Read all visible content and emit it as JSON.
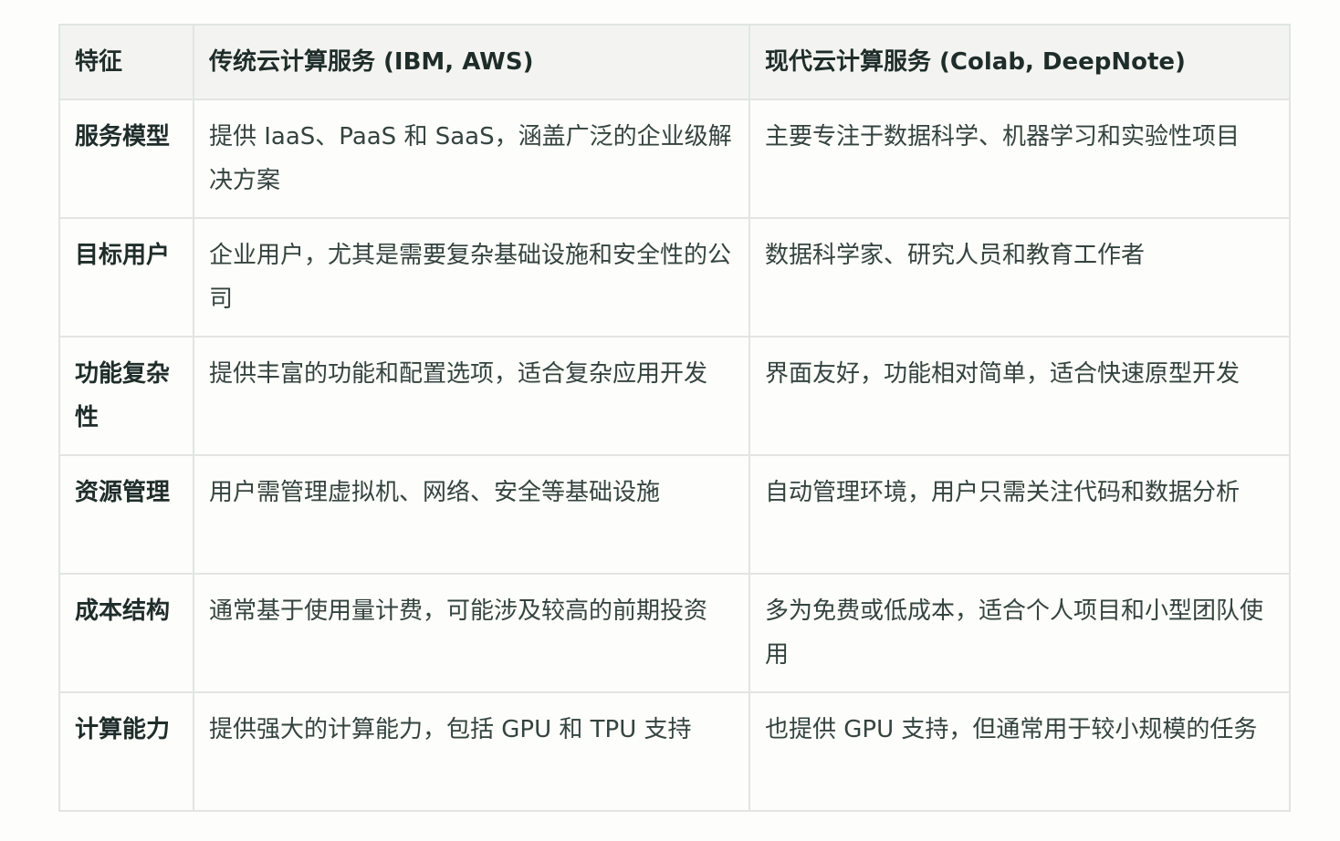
{
  "table": {
    "headers": [
      "特征",
      "传统云计算服务 (IBM, AWS)",
      "现代云计算服务 (Colab, DeepNote)"
    ],
    "rows": [
      [
        "服务模型",
        "提供 IaaS、PaaS 和 SaaS，涵盖广泛的企业级解决方案",
        "主要专注于数据科学、机器学习和实验性项目"
      ],
      [
        "目标用户",
        "企业用户，尤其是需要复杂基础设施和安全性的公司",
        "数据科学家、研究人员和教育工作者"
      ],
      [
        "功能复杂性",
        "提供丰富的功能和配置选项，适合复杂应用开发",
        "界面友好，功能相对简单，适合快速原型开发"
      ],
      [
        "资源管理",
        "用户需管理虚拟机、网络、安全等基础设施",
        "自动管理环境，用户只需关注代码和数据分析"
      ],
      [
        "成本结构",
        "通常基于使用量计费，可能涉及较高的前期投资",
        "多为免费或低成本，适合个人项目和小型团队使用"
      ],
      [
        "计算能力",
        "提供强大的计算能力，包括 GPU 和 TPU 支持",
        "也提供 GPU 支持，但通常用于较小规模的任务"
      ]
    ]
  }
}
